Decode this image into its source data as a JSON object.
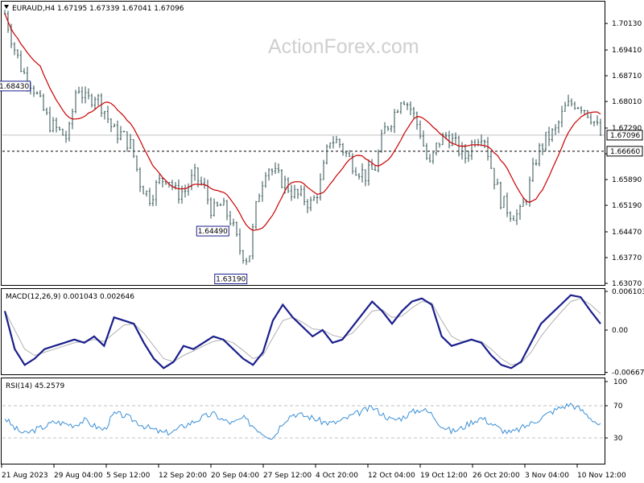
{
  "watermark": "ActionForex.com",
  "header": {
    "main_label": "EURAUD,H4  1.67195 1.67339 1.67041 1.67096",
    "macd_label": "MACD(12,26,9) 0.001043 0.002646",
    "rsi_label": "RSI(14) 45.2579"
  },
  "colors": {
    "candles": "#2f4f4f",
    "ma": "#cc0000",
    "macd_main": "#1a1f8c",
    "macd_signal": "#b0b0b0",
    "rsi": "#3a8fd6",
    "grid": "#c0c0c0",
    "price_box_border": "#1a1f8c"
  },
  "x_axis_labels": [
    "21 Aug 2023",
    "29 Aug 04:00",
    "5 Sep 12:00",
    "12 Sep 20:00",
    "20 Sep 04:00",
    "27 Sep 12:00",
    "4 Oct 20:00",
    "12 Oct 04:00",
    "19 Oct 12:00",
    "26 Oct 20:00",
    "3 Nov 04:00",
    "10 Nov 12:00"
  ],
  "chart_data": [
    {
      "type": "candlestick",
      "title": "EURAUD,H4  1.67195 1.67339 1.67041 1.67096",
      "y_ticks": [
        "1.70130",
        "1.69410",
        "1.68710",
        "1.68010",
        "1.67290",
        "1.66590",
        "1.65890",
        "1.65190",
        "1.64470",
        "1.63770",
        "1.63070"
      ],
      "ylim": [
        1.6307,
        1.7068
      ],
      "current_price": "1.67096",
      "reference_level": "1.66660",
      "annotations": [
        {
          "label": "1.68430",
          "value": 1.6843
        },
        {
          "label": "1.63190",
          "value": 1.6319
        },
        {
          "label": "1.64490",
          "value": 1.6449
        }
      ],
      "price_keypoints": [
        1.704,
        1.695,
        1.688,
        1.685,
        1.679,
        1.674,
        1.672,
        1.67,
        1.685,
        1.68,
        1.682,
        1.678,
        1.672,
        1.671,
        1.668,
        1.658,
        1.654,
        1.658,
        1.66,
        1.655,
        1.656,
        1.66,
        1.657,
        1.65,
        1.652,
        1.648,
        1.64,
        1.637,
        1.654,
        1.663,
        1.66,
        1.658,
        1.655,
        1.654,
        1.652,
        1.658,
        1.67,
        1.669,
        1.665,
        1.662,
        1.66,
        1.662,
        1.672,
        1.676,
        1.682,
        1.678,
        1.672,
        1.662,
        1.669,
        1.671,
        1.668,
        1.665,
        1.67,
        1.672,
        1.661,
        1.653,
        1.65,
        1.649,
        1.656,
        1.666,
        1.67,
        1.672,
        1.678,
        1.68,
        1.679,
        1.676,
        1.671
      ]
    },
    {
      "type": "line",
      "title": "MACD(12,26,9) 0.001043 0.002646",
      "y_ticks": [
        "0.006103",
        "0.00",
        "-0.006679"
      ],
      "ylim": [
        -0.0066,
        0.0061
      ],
      "series": [
        {
          "name": "MACD(12,26,9)",
          "values": [
            0.003,
            -0.003,
            -0.0055,
            -0.0045,
            -0.003,
            -0.0025,
            -0.002,
            -0.0015,
            -0.002,
            -0.001,
            -0.0025,
            0.002,
            0.0015,
            0.001,
            -0.002,
            -0.0045,
            -0.006,
            -0.005,
            -0.0025,
            -0.003,
            -0.002,
            -0.001,
            -0.0015,
            -0.003,
            -0.0045,
            -0.0055,
            -0.0035,
            0.0015,
            0.004,
            0.002,
            0.0005,
            -0.001,
            0.0,
            -0.002,
            -0.0015,
            0.0005,
            0.0025,
            0.0045,
            0.003,
            0.001,
            0.003,
            0.0045,
            0.005,
            0.004,
            -0.001,
            -0.0025,
            -0.002,
            -0.0015,
            -0.002,
            -0.004,
            -0.0055,
            -0.006,
            -0.005,
            -0.002,
            0.001,
            0.0025,
            0.004,
            0.0055,
            0.0052,
            0.003,
            0.001
          ]
        },
        {
          "name": "signal",
          "values": [
            0.003,
            0.0,
            -0.003,
            -0.004,
            -0.0035,
            -0.003,
            -0.0025,
            -0.002,
            -0.0018,
            -0.0015,
            -0.0018,
            -0.0005,
            0.0008,
            0.001,
            -0.0005,
            -0.0025,
            -0.0045,
            -0.005,
            -0.004,
            -0.0033,
            -0.0025,
            -0.0018,
            -0.0015,
            -0.002,
            -0.0032,
            -0.0045,
            -0.004,
            -0.0012,
            0.0015,
            0.002,
            0.0012,
            0.0002,
            0.0,
            -0.0008,
            -0.0012,
            -0.0005,
            0.0012,
            0.003,
            0.0032,
            0.002,
            0.0022,
            0.0035,
            0.0045,
            0.0043,
            0.0015,
            -0.001,
            -0.0018,
            -0.0016,
            -0.0018,
            -0.003,
            -0.0045,
            -0.0055,
            -0.0052,
            -0.0035,
            -0.001,
            0.001,
            0.0028,
            0.0045,
            0.005,
            0.004,
            0.0026
          ]
        }
      ]
    },
    {
      "type": "line",
      "title": "RSI(14) 45.2579",
      "y_ticks": [
        "100",
        "70",
        "30",
        "0"
      ],
      "ylim": [
        0,
        100
      ],
      "series": [
        {
          "name": "RSI(14)",
          "values": [
            55,
            42,
            35,
            40,
            44,
            50,
            48,
            46,
            52,
            45,
            40,
            60,
            58,
            52,
            45,
            40,
            36,
            38,
            45,
            50,
            56,
            60,
            52,
            48,
            55,
            45,
            36,
            30,
            50,
            60,
            58,
            55,
            50,
            48,
            52,
            58,
            63,
            68,
            60,
            52,
            55,
            62,
            66,
            60,
            45,
            38,
            42,
            50,
            55,
            48,
            40,
            36,
            42,
            48,
            55,
            62,
            68,
            72,
            65,
            55,
            45
          ]
        }
      ]
    }
  ]
}
